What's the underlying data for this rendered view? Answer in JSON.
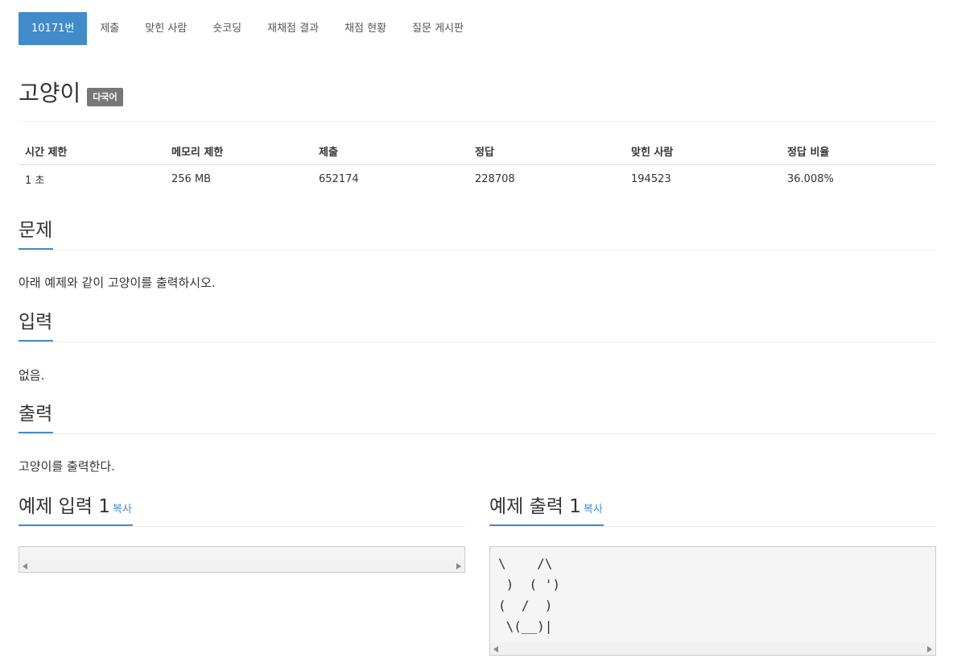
{
  "nav": {
    "tabs": [
      {
        "label": "10171번",
        "active": true
      },
      {
        "label": "제출"
      },
      {
        "label": "맞힌 사람"
      },
      {
        "label": "숏코딩"
      },
      {
        "label": "재채점 결과"
      },
      {
        "label": "채점 현황"
      },
      {
        "label": "질문 게시판"
      }
    ]
  },
  "problem": {
    "title": "고양이",
    "badge": "다국어"
  },
  "info_table": {
    "headers": [
      "시간 제한",
      "메모리 제한",
      "제출",
      "정답",
      "맞힌 사람",
      "정답 비율"
    ],
    "values": [
      "1 초",
      "256 MB",
      "652174",
      "228708",
      "194523",
      "36.008%"
    ]
  },
  "sections": {
    "description": {
      "heading": "문제",
      "text": "아래 예제와 같이 고양이를 출력하시오."
    },
    "input": {
      "heading": "입력",
      "text": "없음."
    },
    "output": {
      "heading": "출력",
      "text": "고양이를 출력한다."
    }
  },
  "samples": {
    "input": {
      "heading": "예제 입력 1",
      "copy_label": "복사",
      "content": ""
    },
    "output": {
      "heading": "예제 출력 1",
      "copy_label": "복사",
      "content": "\\    /\\\n )  ( ')\n(  /  )\n \\(__)|"
    }
  },
  "colors": {
    "accent": "#428bca",
    "badge": "#777777"
  },
  "icons": [
    "scroll-left-icon",
    "scroll-right-icon"
  ]
}
